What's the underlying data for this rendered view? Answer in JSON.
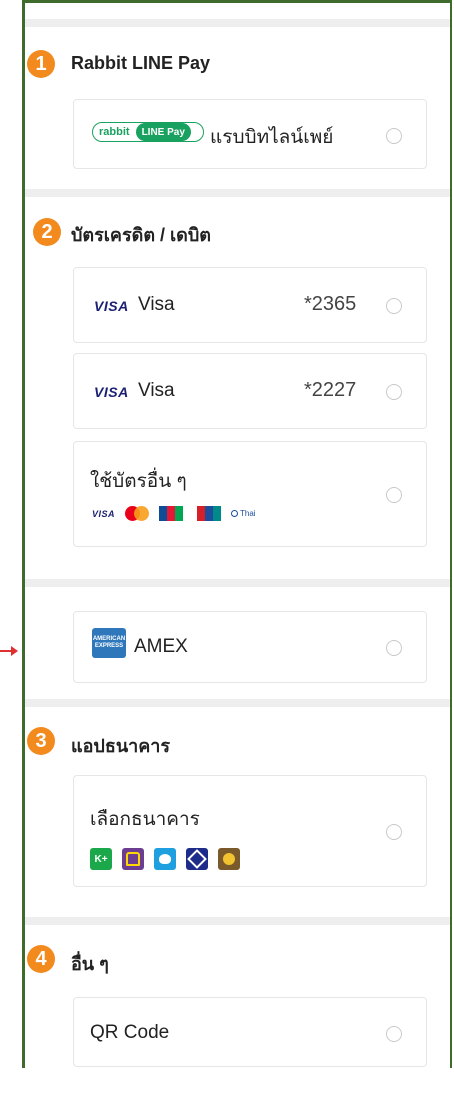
{
  "sections": {
    "rabbit": {
      "number": "1",
      "title": "Rabbit LINE Pay",
      "option": {
        "logo_rabbit": "rabbit",
        "logo_linepay": "LINE Pay",
        "label": "แรบบิทไลน์เพย์"
      }
    },
    "card": {
      "number": "2",
      "title": "บัตรเครดิต / เดบิต",
      "saved_cards": [
        {
          "brand": "VISA",
          "name": "Visa",
          "masked": "*2365"
        },
        {
          "brand": "VISA",
          "name": "Visa",
          "masked": "*2227"
        }
      ],
      "other_card": {
        "label": "ใช้บัตรอื่น ๆ",
        "brands": [
          "visa-icon",
          "mastercard-icon",
          "jcb-icon",
          "unionpay-icon",
          "thai-payment-icon"
        ],
        "visa_text": "VISA",
        "thai_text": "Thai"
      },
      "amex": {
        "label": "AMEX",
        "logo_text": "AMERICAN EXPRESS"
      }
    },
    "bank": {
      "number": "3",
      "title": "แอปธนาคาร",
      "option": {
        "label": "เลือกธนาคาร",
        "banks": [
          {
            "icon": "kplus-icon",
            "text": "K+",
            "color": "#1aa84a"
          },
          {
            "icon": "krungsri-icon",
            "text": "",
            "color": "#6b3e91"
          },
          {
            "icon": "krungthai-icon",
            "text": "",
            "color": "#1ea0e0"
          },
          {
            "icon": "bbl-icon",
            "text": "",
            "color": "#1e2c8a"
          },
          {
            "icon": "scb-icon",
            "text": "",
            "color": "#7a5a2a"
          }
        ]
      }
    },
    "other": {
      "number": "4",
      "title": "อื่น ๆ",
      "option": {
        "label": "QR Code"
      }
    }
  },
  "colors": {
    "badge": "#f28a1e",
    "frame": "#3f6b2d",
    "separator": "#eeeeee",
    "arrow": "#e03030"
  }
}
